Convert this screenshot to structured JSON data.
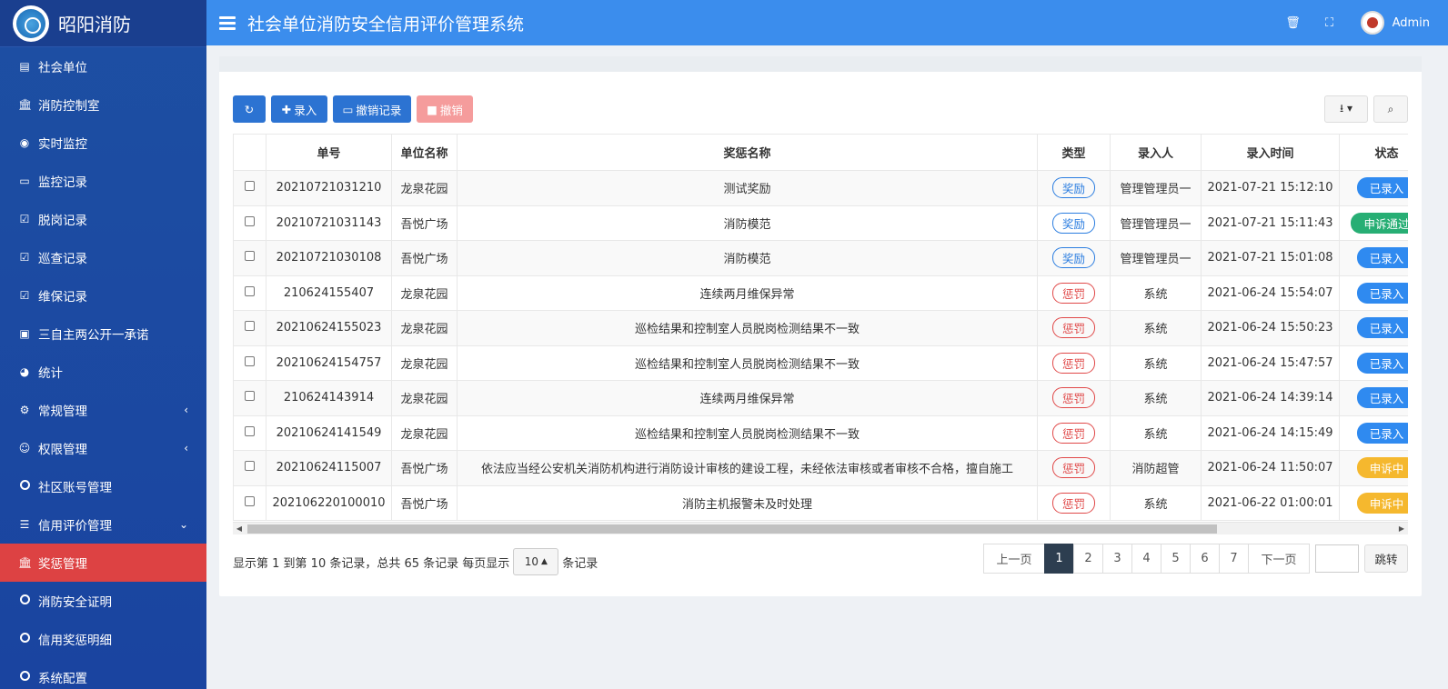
{
  "brand": {
    "title": "昭阳消防"
  },
  "header": {
    "title": "社会单位消防安全信用评价管理系统",
    "user": "Admin"
  },
  "sidebar": {
    "items": [
      {
        "label": "社会单位",
        "icon": "building-icon"
      },
      {
        "label": "消防控制室",
        "icon": "bank-icon"
      },
      {
        "label": "实时监控",
        "icon": "play-circle-icon"
      },
      {
        "label": "监控记录",
        "icon": "monitor-icon"
      },
      {
        "label": "脱岗记录",
        "icon": "calendar-check-icon"
      },
      {
        "label": "巡查记录",
        "icon": "calendar-check-icon"
      },
      {
        "label": "维保记录",
        "icon": "calendar-check-icon"
      },
      {
        "label": "三自主两公开一承诺",
        "icon": "image-icon"
      },
      {
        "label": "统计",
        "icon": "dashboard-icon"
      },
      {
        "label": "常规管理",
        "icon": "cogs-icon"
      },
      {
        "label": "权限管理",
        "icon": "users-icon"
      },
      {
        "label": "社区账号管理",
        "icon": "circle-icon"
      },
      {
        "label": "信用评价管理",
        "icon": "list-icon"
      },
      {
        "label": "奖惩管理",
        "icon": "bank-icon"
      },
      {
        "label": "消防安全证明",
        "icon": "circle-icon"
      },
      {
        "label": "信用奖惩明细",
        "icon": "circle-icon"
      },
      {
        "label": "系统配置",
        "icon": "circle-icon"
      }
    ]
  },
  "toolbar": {
    "add_label": "录入",
    "revoke_record_label": "撤销记录",
    "revoke_label": "撤销"
  },
  "table": {
    "headers": [
      "单号",
      "单位名称",
      "奖惩名称",
      "类型",
      "录入人",
      "录入时间",
      "状态"
    ],
    "rows": [
      {
        "no": "20210721031210",
        "unit": "龙泉花园",
        "name": "测试奖励",
        "type": "奖励",
        "type_color": "blue",
        "by": "管理管理员一",
        "time": "2021-07-21 15:12:10",
        "status": "已录入",
        "status_color": "blue"
      },
      {
        "no": "20210721031143",
        "unit": "吾悦广场",
        "name": "消防模范",
        "type": "奖励",
        "type_color": "blue",
        "by": "管理管理员一",
        "time": "2021-07-21 15:11:43",
        "status": "申诉通过",
        "status_color": "green"
      },
      {
        "no": "20210721030108",
        "unit": "吾悦广场",
        "name": "消防模范",
        "type": "奖励",
        "type_color": "blue",
        "by": "管理管理员一",
        "time": "2021-07-21 15:01:08",
        "status": "已录入",
        "status_color": "blue"
      },
      {
        "no": "210624155407",
        "unit": "龙泉花园",
        "name": "连续两月维保异常",
        "type": "惩罚",
        "type_color": "red",
        "by": "系统",
        "time": "2021-06-24 15:54:07",
        "status": "已录入",
        "status_color": "blue"
      },
      {
        "no": "20210624155023",
        "unit": "龙泉花园",
        "name": "巡检结果和控制室人员脱岗检测结果不一致",
        "type": "惩罚",
        "type_color": "red",
        "by": "系统",
        "time": "2021-06-24 15:50:23",
        "status": "已录入",
        "status_color": "blue"
      },
      {
        "no": "20210624154757",
        "unit": "龙泉花园",
        "name": "巡检结果和控制室人员脱岗检测结果不一致",
        "type": "惩罚",
        "type_color": "red",
        "by": "系统",
        "time": "2021-06-24 15:47:57",
        "status": "已录入",
        "status_color": "blue"
      },
      {
        "no": "210624143914",
        "unit": "龙泉花园",
        "name": "连续两月维保异常",
        "type": "惩罚",
        "type_color": "red",
        "by": "系统",
        "time": "2021-06-24 14:39:14",
        "status": "已录入",
        "status_color": "blue"
      },
      {
        "no": "20210624141549",
        "unit": "龙泉花园",
        "name": "巡检结果和控制室人员脱岗检测结果不一致",
        "type": "惩罚",
        "type_color": "red",
        "by": "系统",
        "time": "2021-06-24 14:15:49",
        "status": "已录入",
        "status_color": "blue"
      },
      {
        "no": "20210624115007",
        "unit": "吾悦广场",
        "name": "依法应当经公安机关消防机构进行消防设计审核的建设工程，未经依法审核或者审核不合格，擅自施工",
        "type": "惩罚",
        "type_color": "red",
        "by": "消防超管",
        "time": "2021-06-24 11:50:07",
        "status": "申诉中",
        "status_color": "yellow"
      },
      {
        "no": "202106220100010",
        "unit": "吾悦广场",
        "name": "消防主机报警未及时处理",
        "type": "惩罚",
        "type_color": "red",
        "by": "系统",
        "time": "2021-06-22 01:00:01",
        "status": "申诉中",
        "status_color": "yellow"
      }
    ]
  },
  "footer": {
    "info_prefix": "显示第 1 到第 10 条记录，总共 65 条记录 每页显示",
    "page_size": "10",
    "info_suffix": "条记录",
    "prev": "上一页",
    "next": "下一页",
    "pages": [
      "1",
      "2",
      "3",
      "4",
      "5",
      "6",
      "7"
    ],
    "current_page": "1",
    "jump": "跳转"
  },
  "colors": {
    "topbar": "#3b8ded",
    "sidebar": "#1d4fa3",
    "active_nav": "#dd4243",
    "primary_button": "#2c73d2"
  }
}
